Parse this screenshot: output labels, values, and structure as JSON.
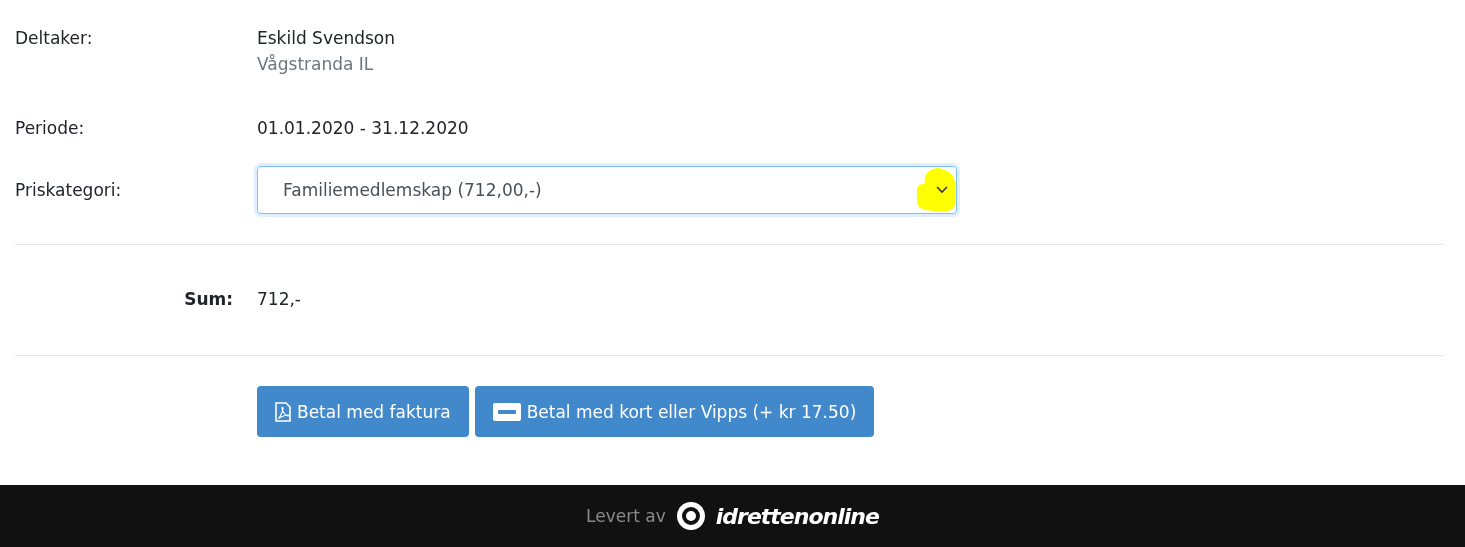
{
  "participant": {
    "label": "Deltaker:",
    "name": "Eskild Svendson",
    "club": "Vågstranda IL"
  },
  "period": {
    "label": "Periode:",
    "value": "01.01.2020 - 31.12.2020"
  },
  "price_category": {
    "label": "Priskategori:",
    "value": "Familiemedlemskap (712,00,-)",
    "highlighted": true
  },
  "sum": {
    "label": "Sum:",
    "value": "712,-"
  },
  "buttons": [
    {
      "kind": "invoice",
      "label": "Betal med faktura"
    },
    {
      "kind": "card",
      "label": "Betal med kort eller Vipps (+ kr 17.50)"
    }
  ],
  "footer": {
    "text": "Levert av",
    "brand": "idrettenonline"
  }
}
